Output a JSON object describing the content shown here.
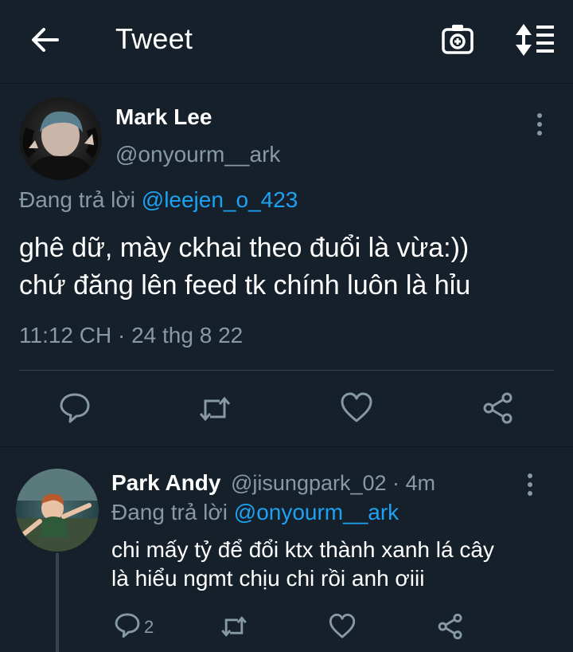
{
  "header": {
    "title": "Tweet"
  },
  "tweet": {
    "author_name": "Mark Lee",
    "author_handle": "@onyourm__ark",
    "replying_prefix": "Đang trả lời",
    "replying_to": "@leejen_o_423",
    "text_line1": "ghê dữ, mày ckhai theo đuổi là vừa:))",
    "text_line2": "chứ đăng lên feed tk chính luôn là hỉu",
    "timestamp": "11:12 CH · 24 thg 8 22"
  },
  "reply": {
    "author_name": "Park Andy",
    "author_handle_time": "@jisungpark_02 · 4m",
    "replying_prefix": "Đang trả lời",
    "replying_to": "@onyourm__ark",
    "text_line1": "chi mấy tỷ để đổi ktx thành xanh lá cây",
    "text_line2": "là hiểu ngmt chịu chi rồi anh ơiii",
    "reply_count": "2"
  },
  "colors": {
    "background": "#15202b",
    "accent": "#1da1f2",
    "secondary_text": "#8899a6",
    "divider": "#38444d"
  }
}
